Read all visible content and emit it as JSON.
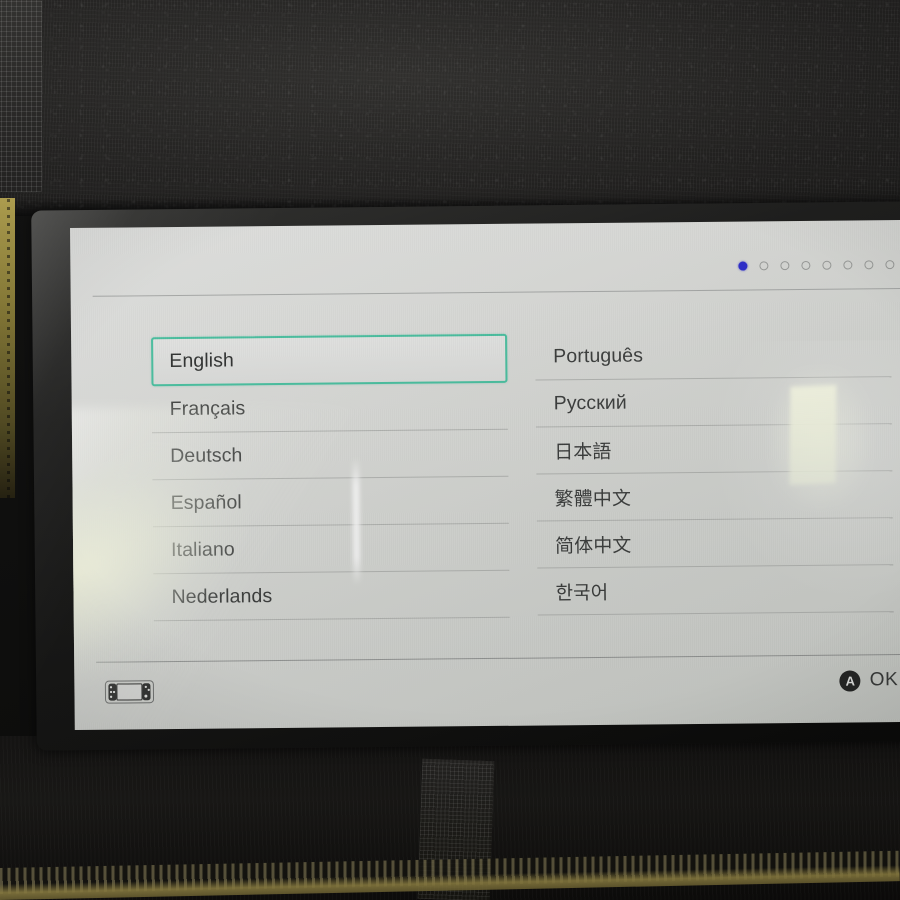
{
  "device": {
    "name": "Nintendo Switch",
    "screen_label": "language-selection-screen"
  },
  "setup": {
    "page_indicator": {
      "total": 8,
      "current": 1,
      "active_color": "#2b2bd0",
      "inactive_color": "#9b9d9b"
    },
    "selection_highlight_color": "#49c3a2",
    "languages": {
      "left_column": [
        {
          "label": "English",
          "selected": true
        },
        {
          "label": "Français",
          "selected": false
        },
        {
          "label": "Deutsch",
          "selected": false
        },
        {
          "label": "Español",
          "selected": false
        },
        {
          "label": "Italiano",
          "selected": false
        },
        {
          "label": "Nederlands",
          "selected": false
        }
      ],
      "right_column": [
        {
          "label": "Português",
          "selected": false
        },
        {
          "label": "Русский",
          "selected": false
        },
        {
          "label": "日本語",
          "selected": false
        },
        {
          "label": "繁體中文",
          "selected": false
        },
        {
          "label": "简体中文",
          "selected": false
        },
        {
          "label": "한국어",
          "selected": false
        }
      ]
    },
    "footer": {
      "mode_icon": "switch-console-handheld-icon",
      "confirm_button_glyph": "A",
      "confirm_label": "OK"
    }
  }
}
